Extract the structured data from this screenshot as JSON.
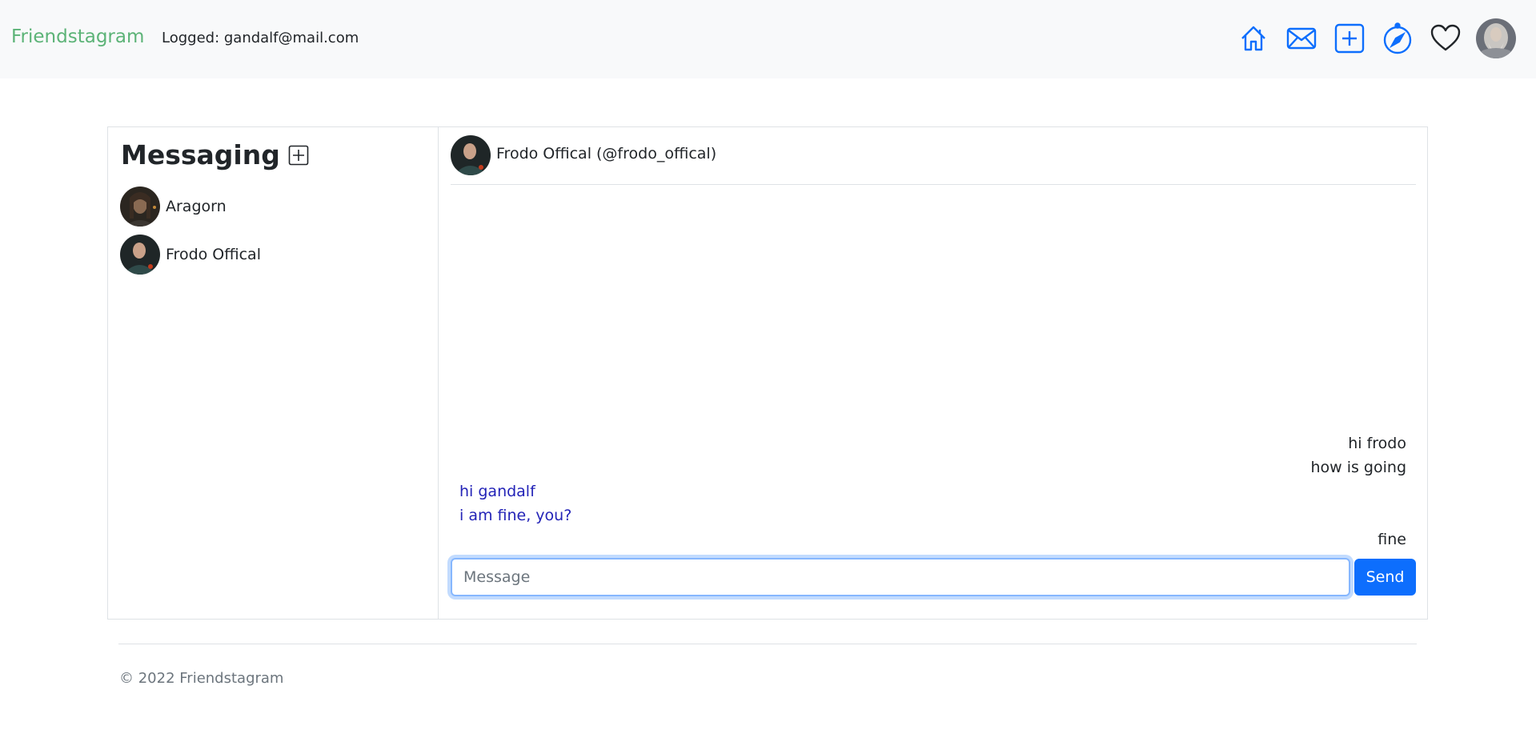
{
  "navbar": {
    "brand": "Friendstagram",
    "logged_text": "Logged: gandalf@mail.com",
    "icons": [
      "home-icon",
      "envelope-icon",
      "plus-square-icon",
      "compass-icon",
      "heart-icon"
    ],
    "accent_color": "#0d6efd",
    "brand_color": "#5cb377"
  },
  "sidebar": {
    "title": "Messaging",
    "contacts": [
      {
        "name": "Aragorn"
      },
      {
        "name": "Frodo Offical"
      }
    ]
  },
  "chat": {
    "header_name": "Frodo Offical (@frodo_offical)",
    "messages": [
      {
        "text": "hi frodo",
        "direction": "sent"
      },
      {
        "text": "how is going",
        "direction": "sent"
      },
      {
        "text": "hi gandalf",
        "direction": "received"
      },
      {
        "text": "i am fine, you?",
        "direction": "received"
      },
      {
        "text": "fine",
        "direction": "sent"
      }
    ],
    "input_placeholder": "Message",
    "input_value": "",
    "send_label": "Send",
    "received_color": "#2323b7"
  },
  "footer": {
    "text": "© 2022 Friendstagram"
  }
}
